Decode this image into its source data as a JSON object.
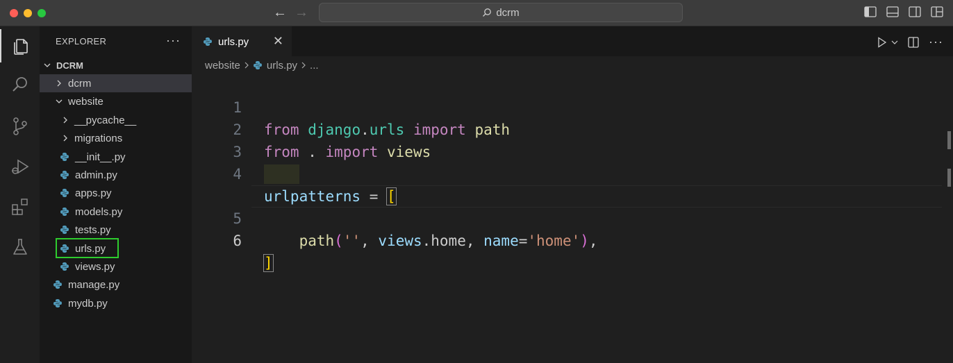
{
  "window": {
    "title": "dcrm"
  },
  "sidebar": {
    "header": "EXPLORER",
    "more": "···",
    "tree": [
      {
        "label": "DCRM",
        "kind": "root",
        "expanded": true,
        "depth": 0
      },
      {
        "label": "dcrm",
        "kind": "folder",
        "expanded": false,
        "depth": 1,
        "selected": true
      },
      {
        "label": "website",
        "kind": "folder",
        "expanded": true,
        "depth": 1
      },
      {
        "label": "__pycache__",
        "kind": "folder",
        "expanded": false,
        "depth": 2
      },
      {
        "label": "migrations",
        "kind": "folder",
        "expanded": false,
        "depth": 2
      },
      {
        "label": "__init__.py",
        "kind": "py",
        "depth": 2
      },
      {
        "label": "admin.py",
        "kind": "py",
        "depth": 2
      },
      {
        "label": "apps.py",
        "kind": "py",
        "depth": 2
      },
      {
        "label": "models.py",
        "kind": "py",
        "depth": 2
      },
      {
        "label": "tests.py",
        "kind": "py",
        "depth": 2
      },
      {
        "label": "urls.py",
        "kind": "py",
        "depth": 2,
        "highlighted": true
      },
      {
        "label": "views.py",
        "kind": "py",
        "depth": 2
      },
      {
        "label": "manage.py",
        "kind": "py",
        "depth": 1
      },
      {
        "label": "mydb.py",
        "kind": "py",
        "depth": 1
      }
    ]
  },
  "editor": {
    "tab": {
      "label": "urls.py",
      "close": "✕"
    },
    "breadcrumb": [
      "website",
      "urls.py",
      "..."
    ],
    "lines": [
      {
        "num": "1",
        "tokens": [
          [
            "kw",
            "from"
          ],
          [
            "",
            "  "
          ],
          [
            "mod",
            "django"
          ],
          [
            "",
            "."
          ],
          [
            "mod",
            "urls"
          ],
          [
            "",
            ""
          ],
          [
            "kw",
            " import"
          ],
          [
            "fn",
            " path"
          ]
        ]
      },
      {
        "num": "2",
        "tokens": [
          [
            "kw",
            "from"
          ],
          [
            "",
            " . "
          ],
          [
            "kw",
            "import"
          ],
          [
            "fn",
            " views"
          ]
        ]
      },
      {
        "num": "3",
        "tokens": []
      },
      {
        "num": "4",
        "tokens": [
          [
            "var",
            "urlpatterns"
          ],
          [
            "",
            " = "
          ],
          [
            "br1",
            "["
          ]
        ]
      },
      {
        "num": "5",
        "tokens": [
          [
            "",
            "    "
          ],
          [
            "fn",
            "path"
          ],
          [
            "br2",
            "("
          ],
          [
            "str",
            "''"
          ],
          [
            "",
            ", "
          ],
          [
            "var",
            "views"
          ],
          [
            "",
            ".home, "
          ],
          [
            "var",
            "name"
          ],
          [
            "",
            "="
          ],
          [
            "str",
            "'home'"
          ],
          [
            "br2",
            ")"
          ],
          [
            "",
            ","
          ]
        ]
      },
      {
        "num": "6",
        "tokens": [
          [
            "br1",
            "]"
          ]
        ]
      }
    ]
  },
  "colors": {
    "accent_highlight": "#2ecc2e",
    "python_icon": "#519aba"
  }
}
